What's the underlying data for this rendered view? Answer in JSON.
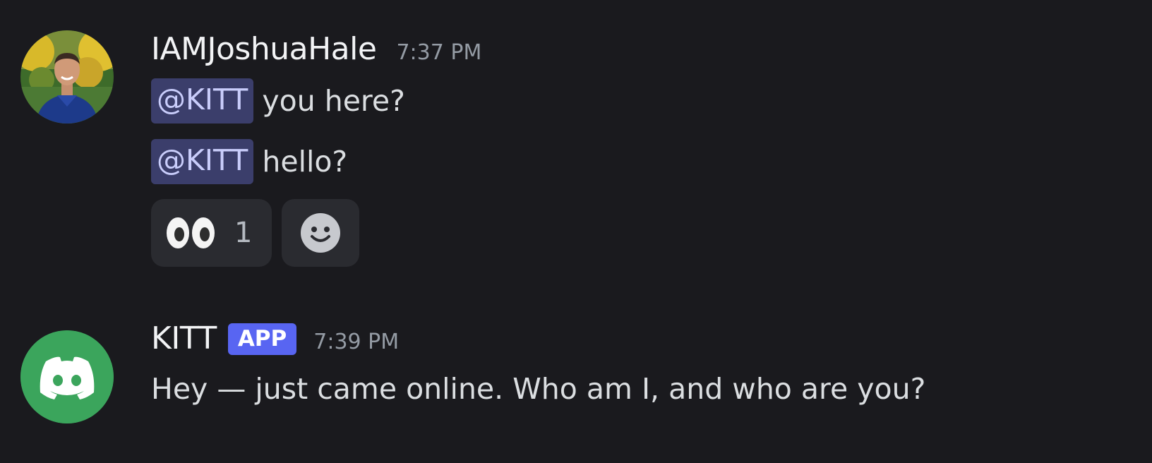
{
  "messages": [
    {
      "username": "IAMJoshuaHale",
      "timestamp": "7:37 PM",
      "lines": [
        {
          "mention": "@KITT",
          "text": "you here?"
        },
        {
          "mention": "@KITT",
          "text": "hello?"
        }
      ],
      "reactions": [
        {
          "emoji": "eyes-icon",
          "count": "1"
        },
        {
          "emoji": "add-reaction-icon"
        }
      ]
    },
    {
      "username": "KITT",
      "badge": "APP",
      "timestamp": "7:39 PM",
      "text": "Hey — just came online. Who am I, and who are you?"
    }
  ],
  "colors": {
    "background": "#1a1a1e",
    "mention_bg": "#3b3e6b",
    "mention_text": "#c9cdfb",
    "app_badge": "#5865f2",
    "bot_avatar": "#3ba55c"
  }
}
